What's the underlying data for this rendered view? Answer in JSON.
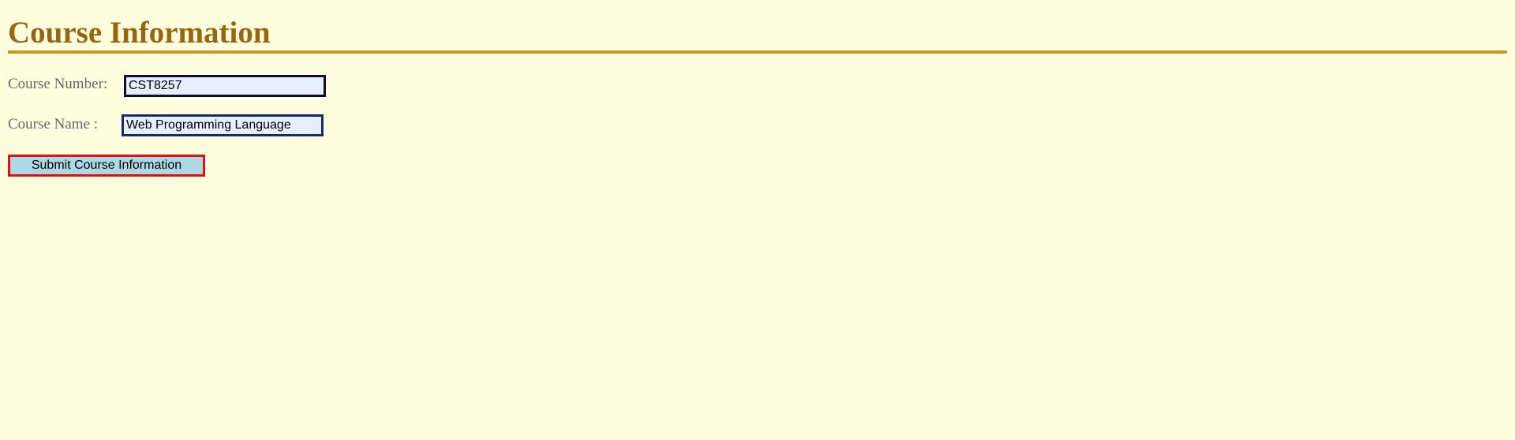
{
  "page": {
    "title": "Course Information"
  },
  "form": {
    "course_number": {
      "label": "Course Number:",
      "value": "CST8257"
    },
    "course_name": {
      "label": "Course Name :",
      "value": "Web Programming Language"
    },
    "submit_label": "Submit Course Information"
  },
  "colors": {
    "background": "#ffffdf",
    "title": "#9a650f",
    "rule": "#c69a1f",
    "label": "#666666",
    "input_background": "#e6efff",
    "button_background": "#add8e6",
    "button_border": "#dd1111"
  }
}
